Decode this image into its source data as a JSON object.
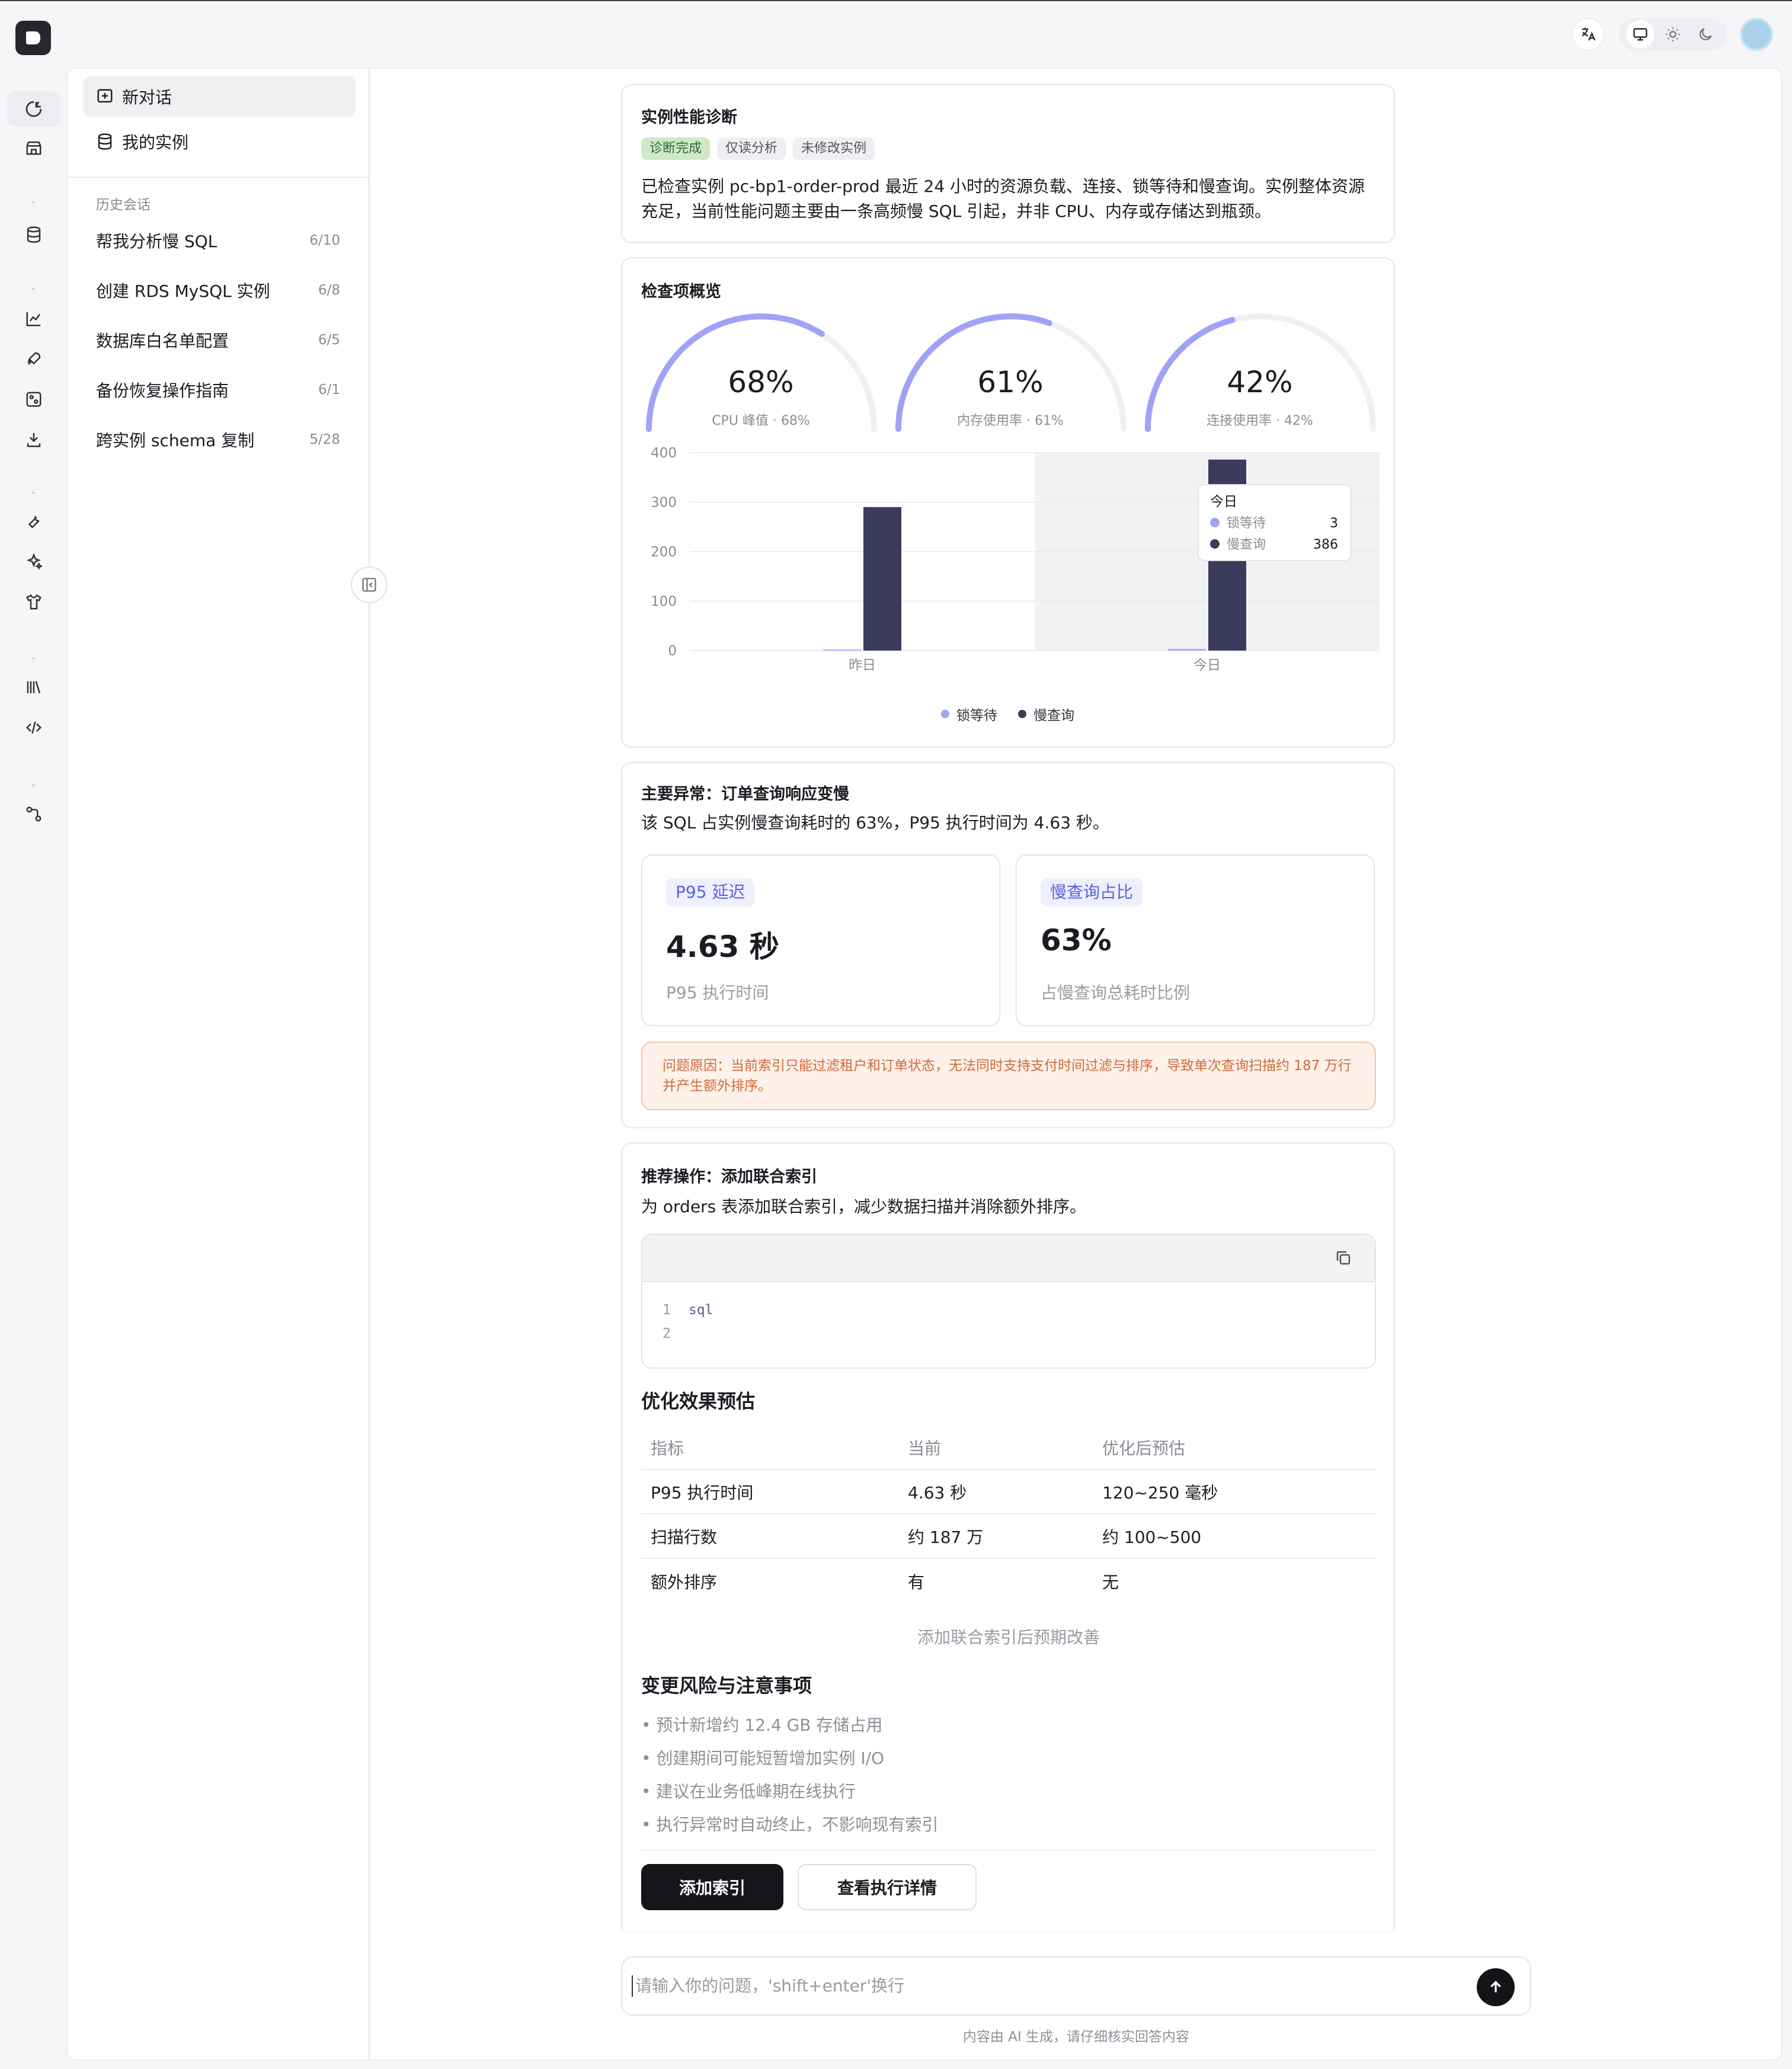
{
  "sidebar": {
    "nav": [
      {
        "label": "新对话"
      },
      {
        "label": "我的实例"
      }
    ],
    "history_title": "历史会话",
    "history": [
      {
        "title": "帮我分析慢 SQL",
        "date": "6/10"
      },
      {
        "title": "创建 RDS MySQL 实例",
        "date": "6/8"
      },
      {
        "title": "数据库白名单配置",
        "date": "6/5"
      },
      {
        "title": "备份恢复操作指南",
        "date": "6/1"
      },
      {
        "title": "跨实例 schema 复制",
        "date": "5/28"
      }
    ]
  },
  "diagnosis": {
    "title": "实例性能诊断",
    "tags": [
      "诊断完成",
      "仅读分析",
      "未修改实例"
    ],
    "summary": "已检查实例 pc-bp1-order-prod 最近 24 小时的资源负载、连接、锁等待和慢查询。实例整体资源充足，当前性能问题主要由一条高频慢 SQL 引起，并非 CPU、内存或存储达到瓶颈。"
  },
  "overview": {
    "title": "检查项概览",
    "gauges": [
      {
        "value": 68,
        "display": "68%",
        "label": "CPU 峰值 · 68%"
      },
      {
        "value": 61,
        "display": "61%",
        "label": "内存使用率 · 61%"
      },
      {
        "value": 42,
        "display": "42%",
        "label": "连接使用率 · 42%"
      }
    ]
  },
  "chart_data": {
    "type": "bar",
    "categories": [
      "昨日",
      "今日"
    ],
    "series": [
      {
        "name": "锁等待",
        "values": [
          2,
          3
        ],
        "color": "#9fa3f5"
      },
      {
        "name": "慢查询",
        "values": [
          290,
          386
        ],
        "color": "#3b3b5c"
      }
    ],
    "ylim": [
      0,
      400
    ],
    "yticks": [
      0,
      100,
      200,
      300,
      400
    ],
    "legend": "bottom",
    "grid": true,
    "tooltip": {
      "title": "今日",
      "rows": [
        {
          "name": "锁等待",
          "value": "3"
        },
        {
          "name": "慢查询",
          "value": "386"
        }
      ]
    }
  },
  "anomaly": {
    "title": "主要异常：订单查询响应变慢",
    "desc": "该 SQL 占实例慢查询耗时的 63%，P95 执行时间为 4.63 秒。",
    "metrics": [
      {
        "label": "P95 延迟",
        "value": "4.63 秒",
        "sub": "P95 执行时间"
      },
      {
        "label": "慢查询占比",
        "value": "63%",
        "sub": "占慢查询总耗时比例"
      }
    ],
    "warning": "问题原因：当前索引只能过滤租户和订单状态，无法同时支持支付时间过滤与排序，导致单次查询扫描约 187 万行并产生额外排序。"
  },
  "recommend": {
    "title": "推荐操作：添加联合索引",
    "desc": "为 orders 表添加联合索引，减少数据扫描并消除额外排序。",
    "code_lines": [
      {
        "n": "1",
        "text": "sql"
      },
      {
        "n": "2",
        "text": ""
      }
    ],
    "effect_title": "优化效果预估",
    "table_head": [
      "指标",
      "当前",
      "优化后预估"
    ],
    "table_rows": [
      [
        "P95 执行时间",
        "4.63 秒",
        "120~250 毫秒"
      ],
      [
        "扫描行数",
        "约 187 万",
        "约 100~500"
      ],
      [
        "额外排序",
        "有",
        "无"
      ]
    ],
    "table_caption": "添加联合索引后预期改善",
    "risk_title": "变更风险与注意事项",
    "risks": [
      "• 预计新增约 12.4 GB 存储占用",
      "• 创建期间可能短暂增加实例 I/O",
      "• 建议在业务低峰期在线执行",
      "• 执行异常时自动终止，不影响现有索引"
    ],
    "primary_button": "添加索引",
    "secondary_button": "查看执行详情"
  },
  "input": {
    "placeholder": "请输入你的问题，'shift+enter'换行",
    "disclaimer": "内容由 AI 生成，请仔细核实回答内容"
  },
  "colors": {
    "accent": "#9fa3f5",
    "dark_bar": "#3b3b5c",
    "warning": "#d06b3a"
  }
}
